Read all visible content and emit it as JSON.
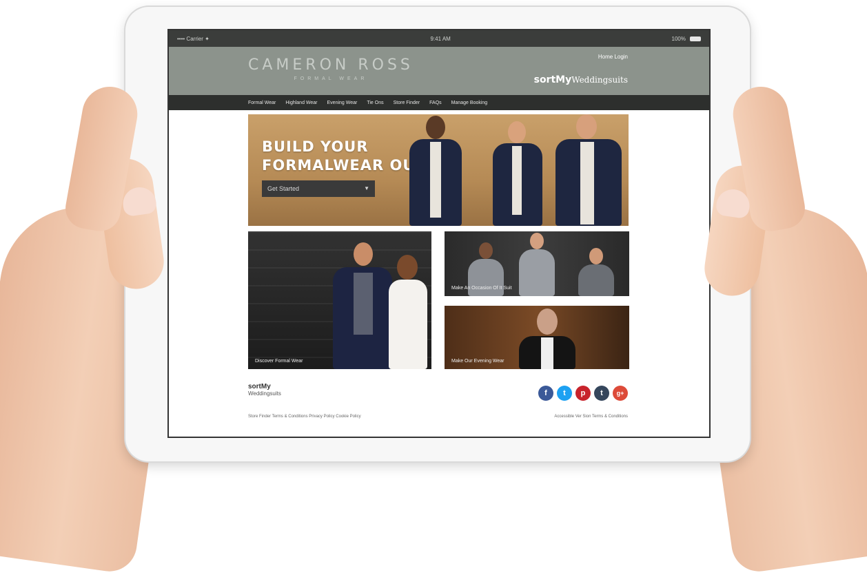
{
  "statusbar": {
    "carrier": "•••• Carrier ✦",
    "time": "9:41 AM",
    "battery_label": "100%"
  },
  "header": {
    "brand_name": "CAMERON ROSS",
    "brand_sub": "FORMAL WEAR",
    "home_login": "Home  Login",
    "partner_a": "sortMy",
    "partner_b": "Weddingsuits"
  },
  "nav": {
    "items": [
      "Formal Wear",
      "Highland Wear",
      "Evening Wear",
      "Tie Ons",
      "Store Finder",
      "FAQs",
      "Manage Booking"
    ]
  },
  "hero": {
    "title_line1": "BUILD YOUR",
    "title_line2": "FORMALWEAR OUTFIT",
    "select_label": "Get Started",
    "caret_icon": "chevron-down-icon"
  },
  "tiles": {
    "a_label": "Discover Formal Wear",
    "b_label": "Make An Occasion Of It Suit",
    "c_label": "Make Our Evening Wear"
  },
  "footer": {
    "logo_a": "sortMy",
    "logo_b": "Weddingsuits",
    "links": "Store Finder  Terms & Conditions  Privacy Policy  Cookie Policy",
    "right_text": "Accessible Ver Sion  Terms & Conditions",
    "social": [
      {
        "icon": "facebook-icon",
        "glyph": "f",
        "color": "#3b5998"
      },
      {
        "icon": "twitter-icon",
        "glyph": "t",
        "color": "#1da1f2"
      },
      {
        "icon": "pinterest-icon",
        "glyph": "p",
        "color": "#c8232c"
      },
      {
        "icon": "tumblr-icon",
        "glyph": "t",
        "color": "#35465c"
      },
      {
        "icon": "googleplus-icon",
        "glyph": "g+",
        "color": "#dd4b39"
      }
    ]
  }
}
